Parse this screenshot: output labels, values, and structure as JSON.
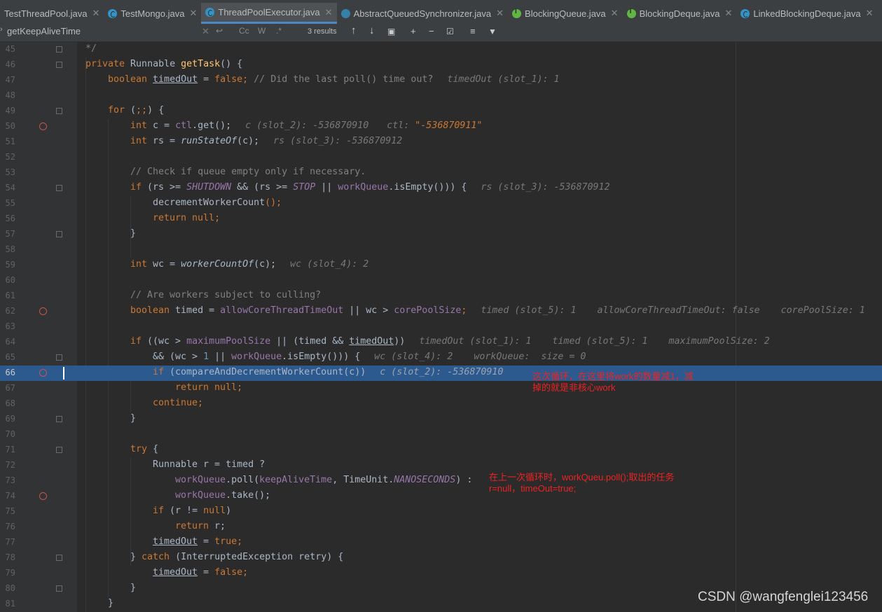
{
  "tabs": [
    {
      "label": "TestThreadPool.java",
      "icon": "java-class-icon",
      "active": false
    },
    {
      "label": "TestMongo.java",
      "icon": "java-class-icon",
      "active": false
    },
    {
      "label": "ThreadPoolExecutor.java",
      "icon": "java-class-icon",
      "active": true
    },
    {
      "label": "AbstractQueuedSynchronizer.java",
      "icon": "abstract-class-icon",
      "active": false
    },
    {
      "label": "BlockingQueue.java",
      "icon": "interface-icon",
      "active": false
    },
    {
      "label": "BlockingDeque.java",
      "icon": "interface-icon",
      "active": false
    },
    {
      "label": "LinkedBlockingDeque.java",
      "icon": "java-class-icon",
      "active": false
    }
  ],
  "search": {
    "query": "getKeepAliveTime",
    "results": "3 results",
    "match_case": "Cc",
    "words": "W",
    "regex": ".*"
  },
  "line_numbers": [
    "45",
    "46",
    "47",
    "48",
    "49",
    "50",
    "51",
    "52",
    "53",
    "54",
    "55",
    "56",
    "57",
    "58",
    "59",
    "60",
    "61",
    "62",
    "63",
    "64",
    "65",
    "66",
    "67",
    "68",
    "69",
    "70",
    "71",
    "72",
    "73",
    "74",
    "75",
    "76",
    "77",
    "78",
    "79",
    "80",
    "81"
  ],
  "breakpoint_lines": [
    "50",
    "62",
    "66",
    "74"
  ],
  "code": {
    "l45": "*/",
    "l46": [
      "private ",
      "Runnable ",
      "getTask",
      "() {"
    ],
    "l47": [
      "boolean ",
      "timedOut",
      " = ",
      "false",
      "; ",
      "// Did the last poll() time out?",
      "timedOut (slot_1): 1"
    ],
    "l49": [
      "for ",
      "(",
      ";;",
      ") {"
    ],
    "l50": [
      "int ",
      "c = ",
      "ctl",
      ".get();",
      "c (slot_2): -536870910",
      "ctl: ",
      "\"-536870911\""
    ],
    "l51": [
      "int ",
      "rs = ",
      "runStateOf",
      "(c);",
      "rs (slot_3): -536870912"
    ],
    "l53": "// Check if queue empty only if necessary.",
    "l54": [
      "if ",
      "(rs >= ",
      "SHUTDOWN",
      " && (rs >= ",
      "STOP",
      " || ",
      "workQueue",
      ".isEmpty())) {",
      "rs (slot_3): -536870912"
    ],
    "l55": [
      "decrementWorkerCount",
      "();"
    ],
    "l56": [
      "return ",
      "null",
      ";"
    ],
    "l57": "}",
    "l59": [
      "int ",
      "wc = ",
      "workerCountOf",
      "(c);",
      "wc (slot_4): 2"
    ],
    "l61": "// Are workers subject to culling?",
    "l62": [
      "boolean ",
      "timed = ",
      "allowCoreThreadTimeOut",
      " || wc > ",
      "corePoolSize",
      ";",
      "timed (slot_5): 1",
      "allowCoreThreadTimeOut: false",
      "corePoolSize: 1"
    ],
    "l64": [
      "if ",
      "((wc > ",
      "maximumPoolSize",
      " || (timed && ",
      "timedOut",
      "))",
      "timedOut (slot_1): 1",
      "timed (slot_5): 1",
      "maximumPoolSize: 2"
    ],
    "l65": [
      "&& (wc > ",
      "1",
      " || ",
      "workQueue",
      ".isEmpty())) {",
      "wc (slot_4): 2",
      "workQueue:  size = 0"
    ],
    "l66": [
      "if ",
      "(compareAndDecrementWorkerCount(c))",
      "c (slot_2): -536870910"
    ],
    "l67": [
      "return ",
      "null",
      ";"
    ],
    "l68": [
      "continue",
      ";"
    ],
    "l69": "}",
    "l71": [
      "try ",
      "{"
    ],
    "l72": [
      "Runnable r = timed ?"
    ],
    "l73": [
      "workQueue",
      ".poll(",
      "keepAliveTime",
      ", TimeUnit.",
      "NANOSECONDS",
      ") :"
    ],
    "l74": [
      "workQueue",
      ".take();"
    ],
    "l75": [
      "if ",
      "(r != ",
      "null",
      ")"
    ],
    "l76": [
      "return ",
      "r;"
    ],
    "l77": [
      "timedOut",
      " = ",
      "true",
      ";"
    ],
    "l78": [
      "} ",
      "catch ",
      "(InterruptedException retry) {"
    ],
    "l79": [
      "timedOut",
      " = ",
      "false",
      ";"
    ],
    "l80": "}",
    "l81": "}"
  },
  "annotations": {
    "a1": "这次循环，在这里将work的数量减1，减\n掉的就是非核心work",
    "a2": "在上一次循环时，workQueu.poll();取出的任务\nr=null，timeOut=true;"
  },
  "watermark": "CSDN @wangfenglei123456",
  "colors": {
    "highlight": "#2d5a8e",
    "keyword": "#cc7832",
    "method": "#ffc66d",
    "field": "#9876aa",
    "annotation": "#ee2222"
  }
}
